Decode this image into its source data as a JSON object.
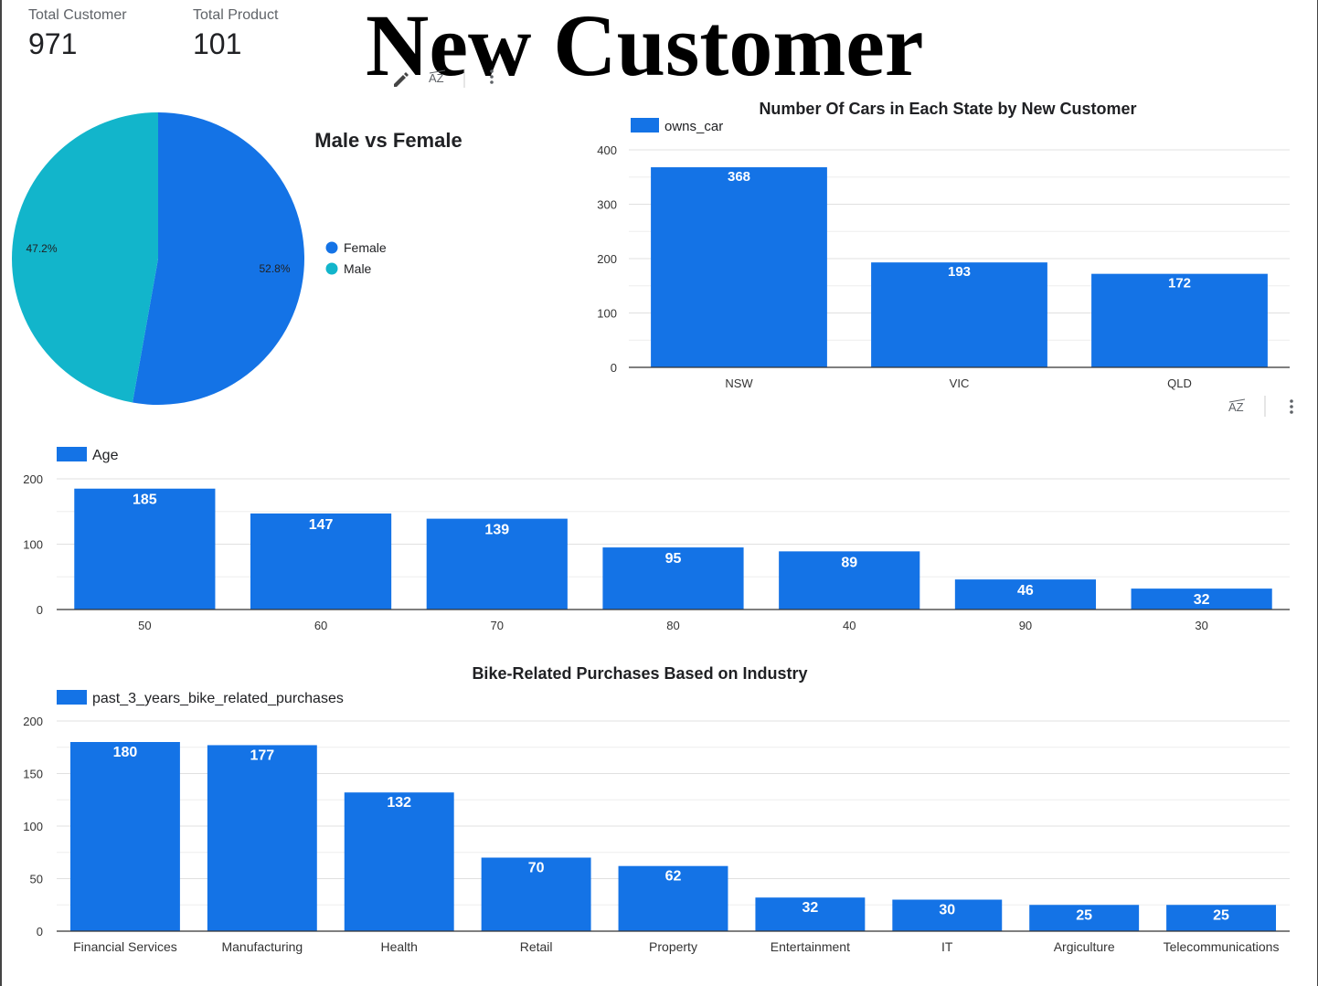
{
  "page": {
    "title": "New Customer",
    "scorecards": [
      {
        "label": "Total Customer",
        "value": "971"
      },
      {
        "label": "Total Product",
        "value": "101"
      }
    ],
    "toolbar_icons": [
      "pencil-icon",
      "sort-az-icon",
      "more-vert-icon"
    ],
    "colors": {
      "bar": "#1473e6",
      "female": "#1473e6",
      "male": "#12b5cb",
      "grid": "#e0e0e0",
      "axis": "#333333"
    }
  },
  "chart_data": [
    {
      "id": "gender",
      "type": "pie",
      "title": "Male vs Female",
      "slices": [
        {
          "label": "Female",
          "value": 52.8,
          "display": "52.8%"
        },
        {
          "label": "Male",
          "value": 47.2,
          "display": "47.2%"
        }
      ],
      "legend": "right"
    },
    {
      "id": "cars",
      "type": "bar",
      "title": "Number Of Cars in Each State by New Customer",
      "legend_label": "owns_car",
      "categories": [
        "NSW",
        "VIC",
        "QLD"
      ],
      "values": [
        368,
        193,
        172
      ],
      "ylim": [
        0,
        400
      ],
      "yticks": [
        0,
        100,
        200,
        300,
        400
      ],
      "grid": true
    },
    {
      "id": "age",
      "type": "bar",
      "title": "",
      "legend_label": "Age",
      "categories": [
        "50",
        "60",
        "70",
        "80",
        "40",
        "90",
        "30"
      ],
      "values": [
        185,
        147,
        139,
        95,
        89,
        46,
        32
      ],
      "ylim": [
        0,
        200
      ],
      "yticks": [
        0,
        100,
        200
      ],
      "grid": true
    },
    {
      "id": "bike",
      "type": "bar",
      "title": "Bike-Related Purchases Based on Industry",
      "legend_label": "past_3_years_bike_related_purchases",
      "categories": [
        "Financial Services",
        "Manufacturing",
        "Health",
        "Retail",
        "Property",
        "Entertainment",
        "IT",
        "Argiculture",
        "Telecommunications"
      ],
      "values": [
        180,
        177,
        132,
        70,
        62,
        32,
        30,
        25,
        25
      ],
      "ylim": [
        0,
        200
      ],
      "yticks": [
        0,
        50,
        100,
        150,
        200
      ],
      "grid": true
    }
  ]
}
